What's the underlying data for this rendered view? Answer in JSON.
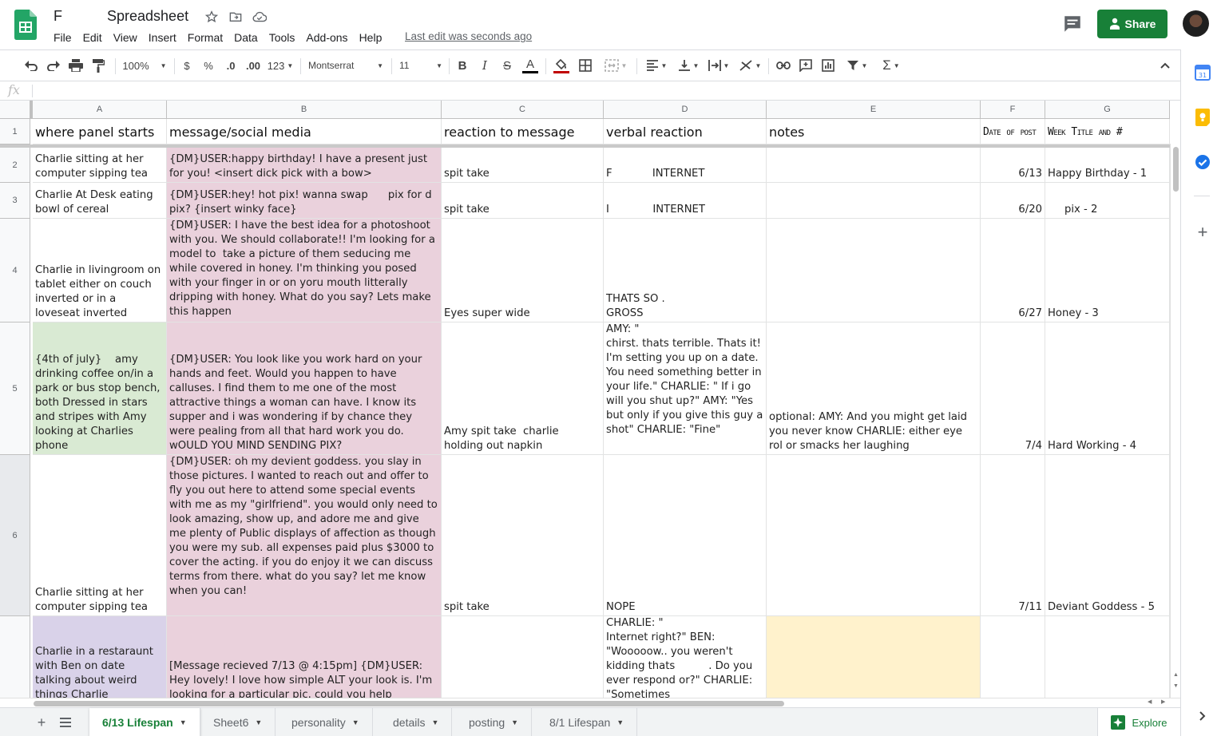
{
  "header": {
    "title_prefix": "F",
    "title": "Spreadsheet",
    "menu": [
      "File",
      "Edit",
      "View",
      "Insert",
      "Format",
      "Data",
      "Tools",
      "Add-ons",
      "Help"
    ],
    "last_edit": "Last edit was seconds ago",
    "share_label": "Share"
  },
  "toolbar": {
    "zoom": "100%",
    "currency": "$",
    "percent": "%",
    "decimal_dec": ".0",
    "decimal_inc": ".00",
    "format_more": "123",
    "font": "Montserrat",
    "font_size": "11",
    "bold": "B",
    "italic": "I",
    "strike": "S",
    "text_color": "A",
    "functions": "Σ",
    "text_color_bar": "#000000",
    "fill_color_bar": "#c00000"
  },
  "formula_bar": {
    "fx": "fx",
    "value": ""
  },
  "grid": {
    "columns": [
      "A",
      "B",
      "C",
      "D",
      "E",
      "F",
      "G"
    ],
    "row_numbers": [
      "1",
      "2",
      "3",
      "4",
      "5",
      "6"
    ],
    "headers": [
      "where panel starts",
      "message/social media",
      "reaction to message",
      "verbal reaction",
      "notes",
      "Date of post",
      "Week Title and #"
    ],
    "rows": [
      {
        "a": "Charlie sitting at her computer sipping tea",
        "b": "{DM}USER:happy birthday! I have a present just for you! <insert dick pick with a bow>",
        "c": "spit take",
        "d": "F            INTERNET",
        "e": "",
        "f": "6/13",
        "g": "Happy Birthday - 1"
      },
      {
        "a": "Charlie At Desk eating bowl of cereal",
        "b": "{DM}USER:hey! hot pix! wanna swap      pix for d      pix? {insert winky face}",
        "c": "spit take",
        "d": "I             INTERNET",
        "e": "",
        "f": "6/20",
        "g": "     pix - 2"
      },
      {
        "a": "Charlie in livingroom on tablet either on couch inverted or in a loveseat inverted",
        "b": "{DM}USER: I have the best idea for a photoshoot with you. We should collaborate!! I'm looking for a model to  take a picture of them seducing me while covered in honey. I'm thinking you posed with your finger in or on yoru mouth litterally dripping with honey. What do you say? Lets make this happen",
        "c": "Eyes super wide",
        "d": "THATS SO .\nGROSS",
        "e": "",
        "f": "6/27",
        "g": "Honey - 3"
      },
      {
        "a": "{4th of july}    amy drinking coffee on/in a park or bus stop bench, both Dressed in stars and stripes with Amy looking at Charlies phone",
        "b": "{DM}USER: You look like you work hard on your hands and feet. Would you happen to have calluses. I find them to me one of the most attractive things a woman can have. I know its supper and i was wondering if by chance they were pealing from all that hard work you do. wOULD YOU MIND SENDING PIX?",
        "c": "Amy spit take  charlie holding out napkin",
        "d": "AMY: \"\nchirst. thats terrible. Thats it! I'm setting you up on a date. You need something better in your life.\" CHARLIE: \" If i go will you shut up?\" AMY: \"Yes but only if you give this guy a shot\" CHARLIE: \"Fine\"",
        "e": "optional: AMY: And you might get laid you never know CHARLIE: either eye rol or smacks her laughing",
        "f": "7/4",
        "g": "Hard Working - 4"
      },
      {
        "a": "Charlie sitting at her computer sipping tea",
        "b": "{DM}USER: oh my devient goddess. you slay in those pictures. I wanted to reach out and offer to fly you out here to attend some special events with me as my \"girlfriend\". you would only need to look amazing, show up, and adore me and give me plenty of Public displays of affection as though you were my sub. all expenses paid plus $3000 to cover the acting. if you do enjoy it we can discuss terms from there. what do you say? let me know when you can!",
        "c": "spit take",
        "d": "NOPE",
        "e": "",
        "f": "7/11",
        "g": "Deviant Goddess - 5"
      },
      {
        "a": "Charlie in a restaraunt with Ben on date talking about weird things Charlie",
        "b": "[Message recieved 7/13 @ 4:15pm] {DM}USER: Hey lovely! I love how simple ALT your look is. I'm looking for a particular pic. could you help",
        "c": "",
        "d": "CHARLIE: \"\nInternet right?\" BEN: \"Wooooow.. you weren't kidding thats          . Do you ever respond or?\" CHARLIE: \"Sometimes",
        "e": "",
        "f": "",
        "g": ""
      }
    ]
  },
  "tabs": [
    {
      "label": "6/13 Lifespan",
      "active": true
    },
    {
      "label": "Sheet6",
      "active": false
    },
    {
      "label": "personality",
      "active": false
    },
    {
      "label": "details",
      "active": false
    },
    {
      "label": "posting",
      "active": false
    },
    {
      "label": "8/1 Lifespan",
      "active": false
    }
  ],
  "explore_label": "Explore",
  "colors": {
    "brand_green": "#188038",
    "cell_pink": "#ead1dc",
    "cell_green": "#d9ead3",
    "cell_purple": "#d9d2e9",
    "cell_yellow": "#fff2cc"
  }
}
